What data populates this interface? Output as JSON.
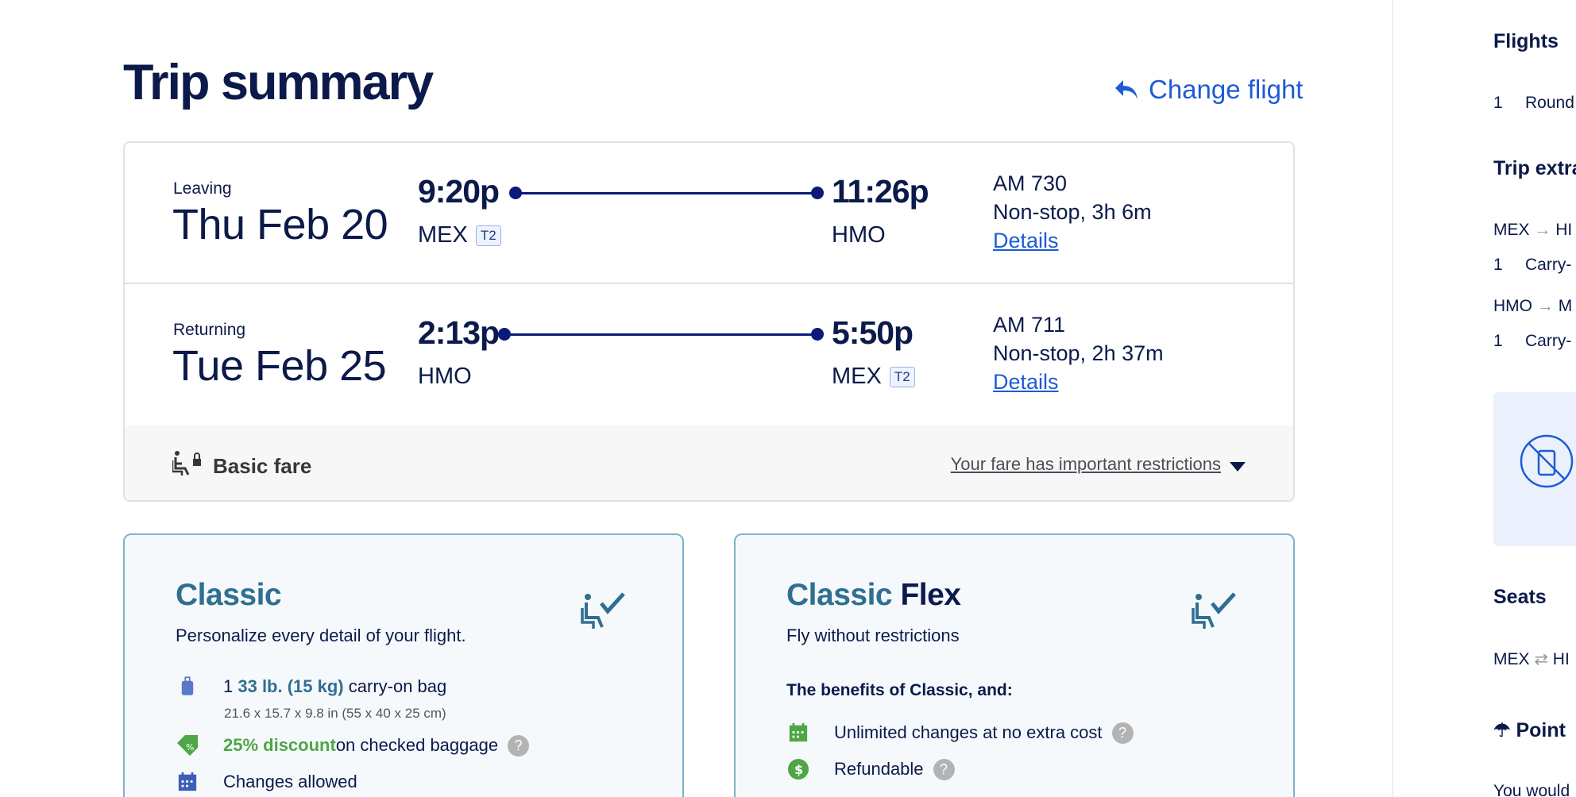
{
  "page": {
    "title": "Trip summary"
  },
  "change_flight": {
    "label": "Change flight",
    "icon": "reply-arrow-icon",
    "color": "#1e5bd6"
  },
  "legs": [
    {
      "kind": "Leaving",
      "date": "Thu Feb 20",
      "dep_time": "9:20p",
      "dep_code": "MEX",
      "dep_terminal": "T2",
      "arr_time": "11:26p",
      "arr_code": "HMO",
      "arr_terminal": "",
      "flight": "AM 730",
      "stops": "Non-stop, 3h 6m",
      "details": "Details"
    },
    {
      "kind": "Returning",
      "date": "Tue Feb 25",
      "dep_time": "2:13p",
      "dep_code": "HMO",
      "dep_terminal": "",
      "arr_time": "5:50p",
      "arr_code": "MEX",
      "arr_terminal": "T2",
      "flight": "AM 711",
      "stops": "Non-stop, 2h 37m",
      "details": "Details"
    }
  ],
  "fare": {
    "name": "Basic fare",
    "restrictions": "Your fare has important restrictions",
    "icon": "seat-lock-icon"
  },
  "plans": [
    {
      "title": "Classic",
      "title_suffix": "",
      "subtitle": "Personalize every detail of your flight.",
      "features": [
        {
          "icon": "carry-on-bag-icon",
          "pre": "1 ",
          "highlight": "33 lb. (15 kg)",
          "post": " carry-on bag",
          "sub": "21.6 x 15.7 x 9.8 in (55 x 40 x 25 cm)"
        },
        {
          "icon": "discount-tag-icon",
          "highlight": "25% discount",
          "post": " on checked baggage",
          "help": "?"
        },
        {
          "icon": "calendar-icon",
          "post": "Changes allowed"
        }
      ]
    },
    {
      "title": "Classic",
      "title_suffix": "Flex",
      "subtitle": "Fly without restrictions",
      "benefits_title": "The benefits of Classic, and:",
      "features": [
        {
          "icon": "calendar-icon",
          "post": "Unlimited changes at no extra cost",
          "help": "?"
        },
        {
          "icon": "dollar-badge-icon",
          "post": "Refundable",
          "help": "?"
        }
      ]
    }
  ],
  "sidebar": {
    "flights_heading": "Flights",
    "flights_count": "1",
    "flights_text": "Round",
    "trip_extras_heading": "Trip extra",
    "extras": [
      {
        "from": "MEX",
        "to": "HI",
        "count": "1",
        "item": "Carry-"
      },
      {
        "from": "HMO",
        "to": "M",
        "count": "1",
        "item": "Carry-"
      }
    ],
    "seats_heading": "Seats",
    "seats_from": "MEX",
    "seats_to": "HI",
    "points_heading": "Point",
    "points_text": "You would"
  },
  "colors": {
    "navy": "#0b1a4a",
    "link": "#1e5bd6",
    "teal": "#2f6f92",
    "green": "#4ea645"
  }
}
